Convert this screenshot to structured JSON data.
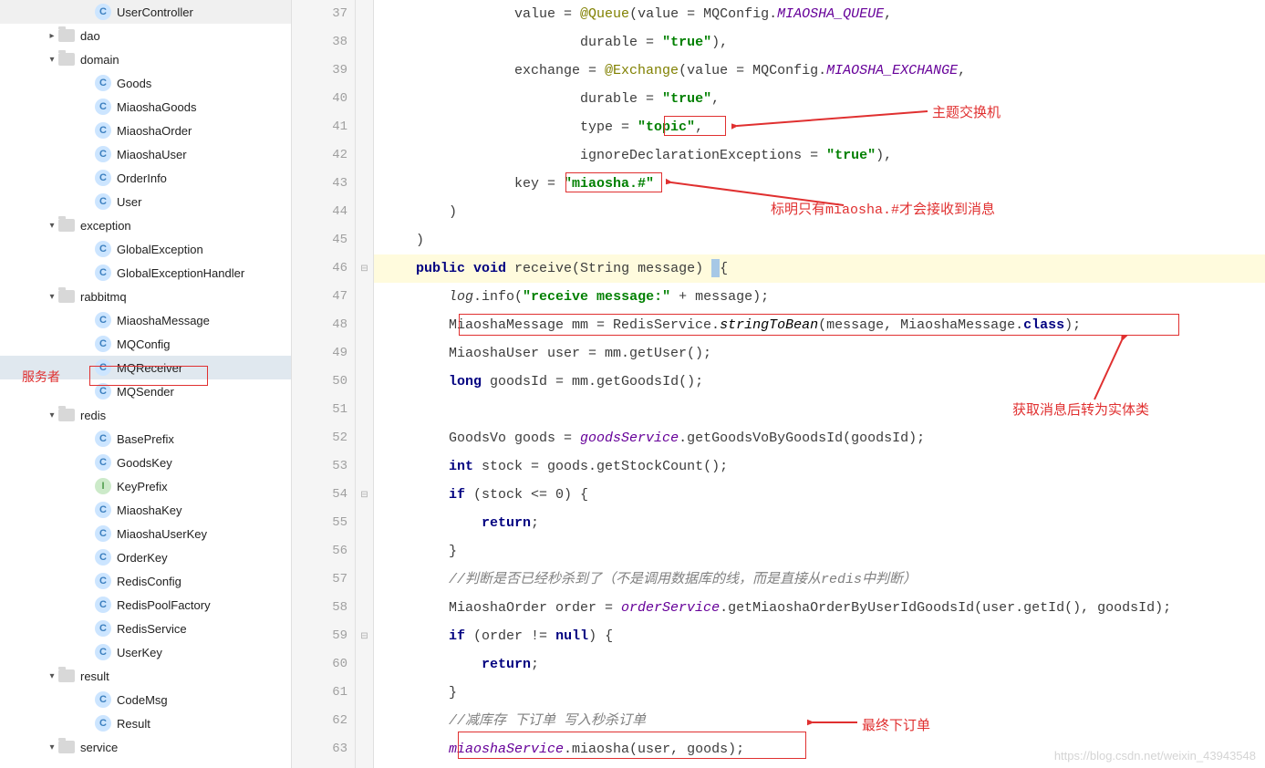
{
  "sidebar": {
    "label_service_consumer": "服务者",
    "items": [
      {
        "depth": 4,
        "icon": "c",
        "label": "UserController",
        "chev": ""
      },
      {
        "depth": 2,
        "icon": "fld",
        "label": "dao",
        "chev": "right"
      },
      {
        "depth": 2,
        "icon": "fld",
        "label": "domain",
        "chev": "down"
      },
      {
        "depth": 4,
        "icon": "c",
        "label": "Goods",
        "chev": ""
      },
      {
        "depth": 4,
        "icon": "c",
        "label": "MiaoshaGoods",
        "chev": ""
      },
      {
        "depth": 4,
        "icon": "c",
        "label": "MiaoshaOrder",
        "chev": ""
      },
      {
        "depth": 4,
        "icon": "c",
        "label": "MiaoshaUser",
        "chev": ""
      },
      {
        "depth": 4,
        "icon": "c",
        "label": "OrderInfo",
        "chev": ""
      },
      {
        "depth": 4,
        "icon": "c",
        "label": "User",
        "chev": ""
      },
      {
        "depth": 2,
        "icon": "fld",
        "label": "exception",
        "chev": "down"
      },
      {
        "depth": 4,
        "icon": "c",
        "label": "GlobalException",
        "chev": ""
      },
      {
        "depth": 4,
        "icon": "c",
        "label": "GlobalExceptionHandler",
        "chev": ""
      },
      {
        "depth": 2,
        "icon": "fld",
        "label": "rabbitmq",
        "chev": "down"
      },
      {
        "depth": 4,
        "icon": "c",
        "label": "MiaoshaMessage",
        "chev": ""
      },
      {
        "depth": 4,
        "icon": "c",
        "label": "MQConfig",
        "chev": ""
      },
      {
        "depth": 4,
        "icon": "c",
        "label": "MQReceiver",
        "chev": "",
        "sel": true
      },
      {
        "depth": 4,
        "icon": "c",
        "label": "MQSender",
        "chev": ""
      },
      {
        "depth": 2,
        "icon": "fld",
        "label": "redis",
        "chev": "down"
      },
      {
        "depth": 4,
        "icon": "c",
        "label": "BasePrefix",
        "chev": ""
      },
      {
        "depth": 4,
        "icon": "c",
        "label": "GoodsKey",
        "chev": ""
      },
      {
        "depth": 4,
        "icon": "i",
        "label": "KeyPrefix",
        "chev": ""
      },
      {
        "depth": 4,
        "icon": "c",
        "label": "MiaoshaKey",
        "chev": ""
      },
      {
        "depth": 4,
        "icon": "c",
        "label": "MiaoshaUserKey",
        "chev": ""
      },
      {
        "depth": 4,
        "icon": "c",
        "label": "OrderKey",
        "chev": ""
      },
      {
        "depth": 4,
        "icon": "c",
        "label": "RedisConfig",
        "chev": ""
      },
      {
        "depth": 4,
        "icon": "c",
        "label": "RedisPoolFactory",
        "chev": ""
      },
      {
        "depth": 4,
        "icon": "c",
        "label": "RedisService",
        "chev": ""
      },
      {
        "depth": 4,
        "icon": "c",
        "label": "UserKey",
        "chev": ""
      },
      {
        "depth": 2,
        "icon": "fld",
        "label": "result",
        "chev": "down"
      },
      {
        "depth": 4,
        "icon": "c",
        "label": "CodeMsg",
        "chev": ""
      },
      {
        "depth": 4,
        "icon": "c",
        "label": "Result",
        "chev": ""
      },
      {
        "depth": 2,
        "icon": "fld",
        "label": "service",
        "chev": "down"
      }
    ]
  },
  "editor": {
    "lines": [
      {
        "n": 37,
        "html": "                value = <span class='ann'>@Queue</span>(value = MQConfig.<span class='fld-it'>MIAOSHA_QUEUE</span>,"
      },
      {
        "n": 38,
        "html": "                        durable = <span class='str'>\"true\"</span>),"
      },
      {
        "n": 39,
        "html": "                exchange = <span class='ann'>@Exchange</span>(value = MQConfig.<span class='fld-it'>MIAOSHA_EXCHANGE</span>,"
      },
      {
        "n": 40,
        "html": "                        durable = <span class='str'>\"true\"</span>,"
      },
      {
        "n": 41,
        "html": "                        type = <span class='str'>\"topic\"</span>,"
      },
      {
        "n": 42,
        "html": "                        ignoreDeclarationExceptions = <span class='str'>\"true\"</span>),"
      },
      {
        "n": 43,
        "html": "                key = <span class='str'>\"miaosha.#\"</span>"
      },
      {
        "n": 44,
        "html": "        )"
      },
      {
        "n": 45,
        "html": "    )"
      },
      {
        "n": 46,
        "html": "    <span class='kw'>public void</span> receive(String message) <span class='cursor-hl'></span>{",
        "hl": true
      },
      {
        "n": 47,
        "html": "        <span class='stat'>log</span>.info(<span class='str'>\"receive message:\"</span> + message);"
      },
      {
        "n": 48,
        "html": "        MiaoshaMessage mm = RedisService.<span class='mtd-it'>stringToBean</span>(message, MiaoshaMessage.<span class='kw'>class</span>);"
      },
      {
        "n": 49,
        "html": "        MiaoshaUser user = mm.getUser();"
      },
      {
        "n": 50,
        "html": "        <span class='kw'>long</span> goodsId = mm.getGoodsId();"
      },
      {
        "n": 51,
        "html": ""
      },
      {
        "n": 52,
        "html": "        GoodsVo goods = <span class='fld-it' style='color:#660099'>goodsService</span>.getGoodsVoByGoodsId(goodsId);"
      },
      {
        "n": 53,
        "html": "        <span class='kw'>int</span> stock = goods.getStockCount();"
      },
      {
        "n": 54,
        "html": "        <span class='kw'>if</span> (stock &lt;= 0) {"
      },
      {
        "n": 55,
        "html": "            <span class='kw'>return</span>;"
      },
      {
        "n": 56,
        "html": "        }"
      },
      {
        "n": 57,
        "html": "        <span class='cmt'>//判断是否已经秒杀到了（不是调用数据库的线，而是直接从redis中判断）</span>"
      },
      {
        "n": 58,
        "html": "        MiaoshaOrder order = <span class='fld-it' style='color:#660099'>orderService</span>.getMiaoshaOrderByUserIdGoodsId(user.getId(), goodsId);"
      },
      {
        "n": 59,
        "html": "        <span class='kw'>if</span> (order != <span class='kw'>null</span>) {"
      },
      {
        "n": 60,
        "html": "            <span class='kw'>return</span>;"
      },
      {
        "n": 61,
        "html": "        }"
      },
      {
        "n": 62,
        "html": "        <span class='cmt'>//减库存 下订单 写入秒杀订单</span>"
      },
      {
        "n": 63,
        "html": "        <span class='fld-it' style='color:#660099'>miaoshaService</span>.miaosha(user, goods);"
      }
    ],
    "annotations": {
      "a1": "主题交换机",
      "a2": "标明只有miaosha.#才会接收到消息",
      "a3": "获取消息后转为实体类",
      "a4": "最终下订单"
    }
  },
  "watermark": "https://blog.csdn.net/weixin_43943548"
}
